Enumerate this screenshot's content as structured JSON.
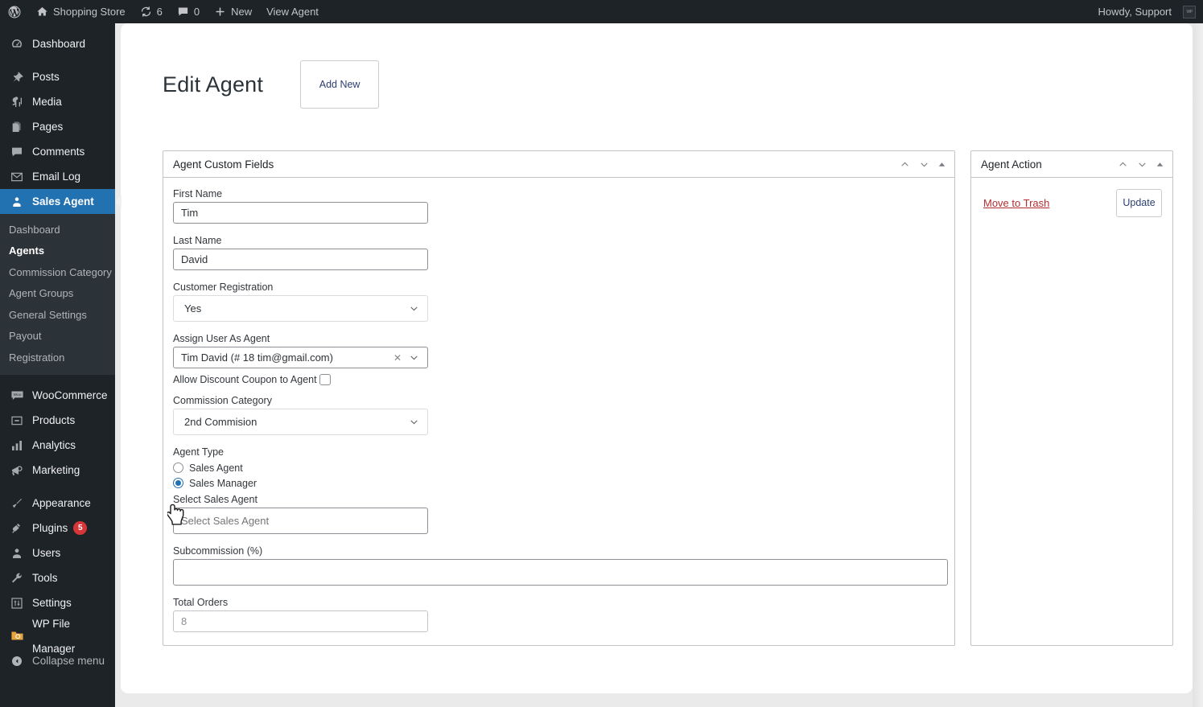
{
  "adminbar": {
    "wp_logo_icon": "wordpress-logo-icon",
    "site_icon": "home-icon",
    "site_name": "Shopping Store",
    "updates_icon": "updates-icon",
    "updates_count": "6",
    "comments_icon": "comment-bubble-icon",
    "comments_count": "0",
    "new_icon": "plus-icon",
    "new_label": "New",
    "view_agent_label": "View Agent",
    "howdy": "Howdy, Support",
    "avatar_icon": "avatar-icon"
  },
  "sidebar": {
    "items": [
      {
        "label": "Dashboard",
        "icon": "dashboard-icon"
      },
      {
        "label": "Posts",
        "icon": "pin-icon"
      },
      {
        "label": "Media",
        "icon": "media-icon"
      },
      {
        "label": "Pages",
        "icon": "pages-icon"
      },
      {
        "label": "Comments",
        "icon": "comment-bubble-icon"
      },
      {
        "label": "Email Log",
        "icon": "envelope-icon"
      },
      {
        "label": "Sales Agent",
        "icon": "user-badge-icon"
      },
      {
        "label": "WooCommerce",
        "icon": "woocommerce-icon"
      },
      {
        "label": "Products",
        "icon": "products-icon"
      },
      {
        "label": "Analytics",
        "icon": "bar-chart-icon"
      },
      {
        "label": "Marketing",
        "icon": "megaphone-icon"
      },
      {
        "label": "Appearance",
        "icon": "paintbrush-icon"
      },
      {
        "label": "Plugins",
        "icon": "plug-icon",
        "badge": "5"
      },
      {
        "label": "Users",
        "icon": "user-icon"
      },
      {
        "label": "Tools",
        "icon": "wrench-icon"
      },
      {
        "label": "Settings",
        "icon": "sliders-icon"
      },
      {
        "label": "WP File Manager",
        "icon": "folder-icon"
      },
      {
        "label": "Collapse menu",
        "icon": "collapse-arrow-icon"
      }
    ],
    "submenu": [
      {
        "label": "Dashboard"
      },
      {
        "label": "Agents"
      },
      {
        "label": "Commission Category"
      },
      {
        "label": "Agent Groups"
      },
      {
        "label": "General Settings"
      },
      {
        "label": "Payout"
      },
      {
        "label": "Registration"
      }
    ]
  },
  "page": {
    "title": "Edit Agent",
    "add_new_label": "Add New"
  },
  "main_box": {
    "title": "Agent Custom Fields",
    "collapse_up_icon": "chevron-up-icon",
    "collapse_down_icon": "chevron-down-icon",
    "toggle_icon": "triangle-up-icon",
    "fields": {
      "first_name": {
        "label": "First Name",
        "value": "Tim"
      },
      "last_name": {
        "label": "Last Name",
        "value": "David"
      },
      "customer_registration": {
        "label": "Customer Registration",
        "value": "Yes"
      },
      "assign_user": {
        "label": "Assign User As Agent",
        "value": "Tim David (# 18 tim@gmail.com)",
        "clear_icon": "clear-x-icon",
        "dropdown_icon": "chevron-down-icon"
      },
      "allow_coupon": {
        "label": "Allow Discount Coupon to Agent",
        "checked": false
      },
      "commission_category": {
        "label": "Commission Category",
        "value": "2nd Commision"
      },
      "agent_type": {
        "label": "Agent Type",
        "options": [
          {
            "label": "Sales Agent",
            "selected": false
          },
          {
            "label": "Sales Manager",
            "selected": true
          }
        ]
      },
      "select_sales_agent": {
        "label": "Select Sales Agent",
        "placeholder": "Select Sales Agent",
        "value": ""
      },
      "subcommission": {
        "label": "Subcommission (%)",
        "value": ""
      },
      "total_orders": {
        "label": "Total Orders",
        "value": "8"
      }
    }
  },
  "side_box": {
    "title": "Agent Action",
    "collapse_up_icon": "chevron-up-icon",
    "collapse_down_icon": "chevron-down-icon",
    "toggle_icon": "triangle-up-icon",
    "trash_label": "Move to Trash",
    "update_label": "Update"
  },
  "cursor": {
    "icon": "pointer-hand-cursor"
  },
  "colors": {
    "admin_bar": "#1d2327",
    "menu_bg": "#1d2327",
    "menu_active": "#2271b1",
    "submenu_bg": "#2c3338",
    "badge_red": "#d63638",
    "trash_red": "#b32d2e",
    "link_blue": "#2c3e70"
  }
}
